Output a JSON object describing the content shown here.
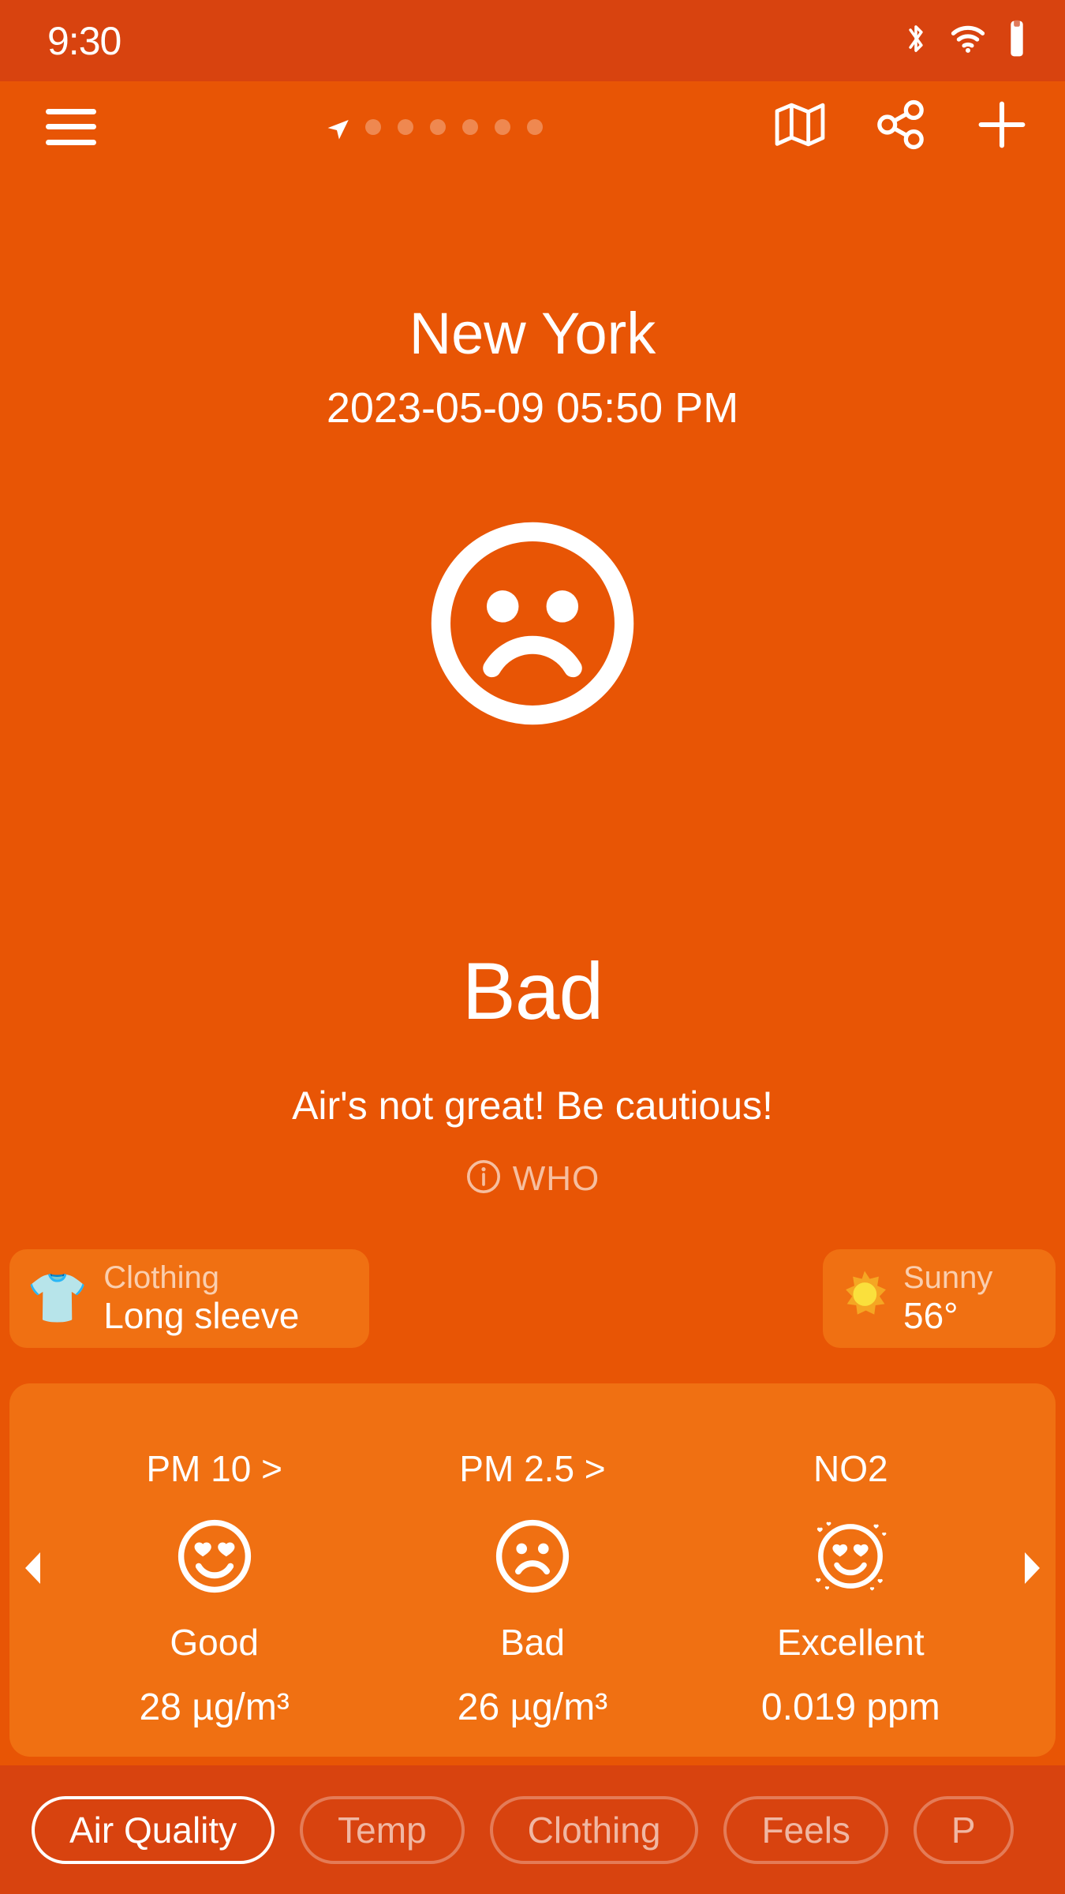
{
  "status_bar": {
    "time": "9:30",
    "icons": [
      "bluetooth-icon",
      "wifi-icon",
      "battery-icon"
    ]
  },
  "header": {
    "menu_icon": "hamburger-menu-icon",
    "location_icon": "location-arrow-icon",
    "page_dots": 6,
    "actions": [
      {
        "icon": "map-icon",
        "name": "map-button"
      },
      {
        "icon": "share-icon",
        "name": "share-button"
      },
      {
        "icon": "plus-icon",
        "name": "add-location-button"
      }
    ]
  },
  "hero": {
    "city": "New York",
    "datetime": "2023-05-09 05:50 PM",
    "face_icon": "sad-face-icon",
    "level": "Bad",
    "message": "Air's not great! Be cautious!",
    "source_icon": "info-icon",
    "source": "WHO"
  },
  "info_cards": {
    "clothing": {
      "icon": "long-sleeve-shirt-icon",
      "label": "Clothing",
      "value": "Long sleeve"
    },
    "weather": {
      "icon": "sun-icon",
      "label": "Sunny",
      "value": "56°"
    }
  },
  "pollutants": {
    "prev_icon": "chevron-left-icon",
    "next_icon": "chevron-right-icon",
    "items": [
      {
        "name": "PM 10 >",
        "face": "heart-eyes-face-icon",
        "status": "Good",
        "value": "28 µg/m³"
      },
      {
        "name": "PM 2.5 >",
        "face": "sad-face-icon",
        "status": "Bad",
        "value": "26 µg/m³"
      },
      {
        "name": "NO2",
        "face": "sparkling-heart-eyes-face-icon",
        "status": "Excellent",
        "value": "0.019 ppm"
      }
    ]
  },
  "tabs": {
    "items": [
      {
        "label": "Air Quality",
        "active": true
      },
      {
        "label": "Temp",
        "active": false
      },
      {
        "label": "Clothing",
        "active": false
      },
      {
        "label": "Feels",
        "active": false
      },
      {
        "label": "P",
        "active": false
      }
    ]
  },
  "colors": {
    "background": "#E85505",
    "status_bar": "#D8430F",
    "card": "#F07012",
    "text": "#FFFFFF"
  }
}
